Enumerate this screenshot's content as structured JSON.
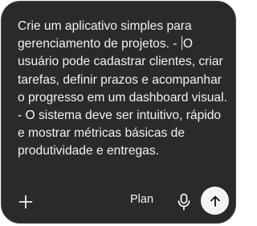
{
  "composer": {
    "text_before_caret": "Crie um aplicativo simples para gerenciamento de projetos. - ",
    "text_after_caret": "O usuário pode cadastrar clientes, criar tarefas, definir prazos e acompanhar o progresso em um dashboard visual. - O sistema deve ser intuitivo, rápido e mostrar métricas básicas de produtividade e entregas."
  },
  "toolbar": {
    "plan_label": "Plan",
    "add_icon": "plus-icon",
    "mic_icon": "microphone-icon",
    "send_icon": "arrow-up-icon"
  },
  "colors": {
    "panel_background": "#2a2a2a",
    "text": "#f2f2f2",
    "send_button_background": "#f4f4f4",
    "send_icon": "#111111"
  }
}
